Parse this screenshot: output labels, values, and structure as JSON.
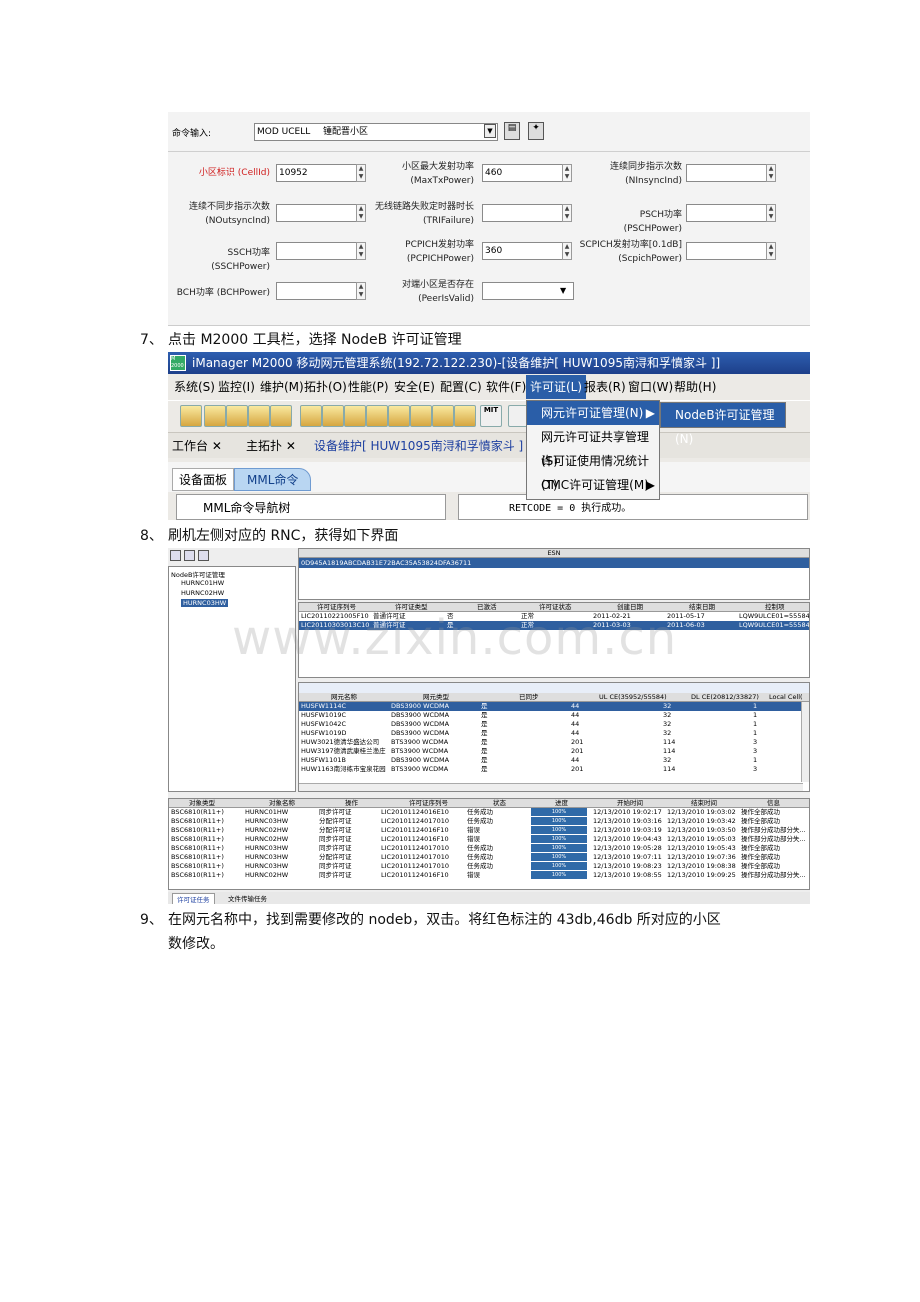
{
  "shot1": {
    "cmd_label": "命令输入:",
    "cmd_value": "MOD UCELL",
    "cmd_desc": "锺配晋小区",
    "fields": [
      {
        "label": "小区标识 (CellId)",
        "value": "10952"
      },
      {
        "label": "小区最大发射功率\n(MaxTxPower)",
        "value": "460"
      },
      {
        "label": "连续同步指示次数\n(NInsyncInd)",
        "value": ""
      },
      {
        "label": "连续不同步指示次数\n(NOutsyncInd)",
        "value": ""
      },
      {
        "label": "无线链路失败定时器时长\n(TRIFailure)",
        "value": ""
      },
      {
        "label": "PSCH功率 (PSCHPower)",
        "value": ""
      },
      {
        "label": "SSCH功率 (SSCHPower)",
        "value": ""
      },
      {
        "label": "PCPICH发射功率\n(PCPICHPower)",
        "value": "360"
      },
      {
        "label": "SCPICH发射功率[0.1dB]\n(ScpichPower)",
        "value": ""
      },
      {
        "label": "BCH功率 (BCHPower)",
        "value": ""
      },
      {
        "label": "对端小区是否存在\n(PeerIsValid)",
        "value": ""
      }
    ]
  },
  "step7": {
    "num": "7、",
    "text": "点击 M2000 工具栏，选择 NodeB 许可证管理"
  },
  "shot2": {
    "title": "iManager M2000 移动网元管理系统(192.72.122.230)-[设备维护[ HUW1095南浔和孚憤家斗 ]]",
    "menus": [
      "系统(S)",
      "监控(I)",
      "维护(M)",
      "拓扑(O)",
      "性能(P)",
      "安全(E)",
      "配置(C)",
      "软件(F)",
      "许可证(L)",
      "报表(R)",
      "窗口(W)",
      "帮助(H)"
    ],
    "tabs": [
      "工作台",
      "主拓扑",
      "设备维护[ HUW1095南浔和孚憤家斗 ]"
    ],
    "subtabs": [
      "设备面板",
      "MML命令"
    ],
    "tree_item": "MML命令导航树",
    "retcode": "RETCODE = 0  执行成功。",
    "dropdown": [
      "网元许可证管理(N)",
      "网元许可证共享管理(S)",
      "许可证使用情况统计(T)",
      "OMC许可证管理(M)"
    ],
    "submenu": "NodeB许可证管理(N)"
  },
  "step8": {
    "num": "8、",
    "text": "刷机左侧对应的 RNC，获得如下界面"
  },
  "shot3": {
    "tree_root": "NodeB许可证管理",
    "tree_items": [
      "HURNC01HW",
      "HURNC02HW",
      "HURNC03HW"
    ],
    "esn_header": "ESN",
    "esn_value": "0D945A1819ABCDAB31E72BAC35A53824DFA36711",
    "lic_headers": [
      "许可证序列号",
      "许可证类型",
      "已激活",
      "许可证状态",
      "创建日期",
      "结束日期",
      "控制项"
    ],
    "lic_rows": [
      [
        "LIC20110221005F10",
        "普通许可证",
        "否",
        "正常",
        "2011-02-21",
        "2011-05-17",
        "LQW9ULCE01=55584,..."
      ],
      [
        "LIC20110303013C10",
        "普通许可证",
        "是",
        "正常",
        "2011-03-03",
        "2011-06-03",
        "LQW9ULCE01=55584,..."
      ]
    ],
    "ne_headers": [
      "网元名称",
      "网元类型",
      "已同步",
      "UL CE(35952/55584)",
      "DL CE(20812/33827)",
      "Local Cell("
    ],
    "ne_rows": [
      [
        "HUSFW1114C",
        "DBS3900 WCDMA",
        "是",
        "44",
        "32",
        "1"
      ],
      [
        "HUSFW1019C",
        "DBS3900 WCDMA",
        "是",
        "44",
        "32",
        "1"
      ],
      [
        "HUSFW1042C",
        "DBS3900 WCDMA",
        "是",
        "44",
        "32",
        "1"
      ],
      [
        "HUSFW1019D",
        "DBS3900 WCDMA",
        "是",
        "44",
        "32",
        "1"
      ],
      [
        "HUW3021德清华盛达公司",
        "BTS3900 WCDMA",
        "是",
        "201",
        "114",
        "3"
      ],
      [
        "HUW3197德清武康桂兰渔庄",
        "BTS3900 WCDMA",
        "是",
        "201",
        "114",
        "3"
      ],
      [
        "HUSFW1101B",
        "DBS3900 WCDMA",
        "是",
        "44",
        "32",
        "1"
      ],
      [
        "HUW1163南浔练市宝泉花园",
        "BTS3900 WCDMA",
        "是",
        "201",
        "114",
        "3"
      ]
    ],
    "task_headers": [
      "对象类型",
      "对象名称",
      "操作",
      "许可证序列号",
      "状态",
      "进度",
      "开始时间",
      "结束时间",
      "信息"
    ],
    "task_rows": [
      [
        "BSC6810(R11+)",
        "HURNC01HW",
        "同步许可证",
        "LIC20101124016E10",
        "任务成功",
        "100%",
        "12/13/2010 19:02:17",
        "12/13/2010 19:03:02",
        "操作全部成功"
      ],
      [
        "BSC6810(R11+)",
        "HURNC03HW",
        "分配许可证",
        "LIC20101124017010",
        "任务成功",
        "100%",
        "12/13/2010 19:03:16",
        "12/13/2010 19:03:42",
        "操作全部成功"
      ],
      [
        "BSC6810(R11+)",
        "HURNC02HW",
        "分配许可证",
        "LIC20101124016F10",
        "错误",
        "100%",
        "12/13/2010 19:03:19",
        "12/13/2010 19:03:50",
        "操作部分成功部分失..."
      ],
      [
        "BSC6810(R11+)",
        "HURNC02HW",
        "同步许可证",
        "LIC20101124016F10",
        "错误",
        "100%",
        "12/13/2010 19:04:43",
        "12/13/2010 19:05:03",
        "操作部分成功部分失..."
      ],
      [
        "BSC6810(R11+)",
        "HURNC03HW",
        "同步许可证",
        "LIC20101124017010",
        "任务成功",
        "100%",
        "12/13/2010 19:05:28",
        "12/13/2010 19:05:43",
        "操作全部成功"
      ],
      [
        "BSC6810(R11+)",
        "HURNC03HW",
        "分配许可证",
        "LIC20101124017010",
        "任务成功",
        "100%",
        "12/13/2010 19:07:11",
        "12/13/2010 19:07:36",
        "操作全部成功"
      ],
      [
        "BSC6810(R11+)",
        "HURNC03HW",
        "同步许可证",
        "LIC20101124017010",
        "任务成功",
        "100%",
        "12/13/2010 19:08:23",
        "12/13/2010 19:08:38",
        "操作全部成功"
      ],
      [
        "BSC6810(R11+)",
        "HURNC02HW",
        "同步许可证",
        "LIC20101124016F10",
        "错误",
        "100%",
        "12/13/2010 19:08:55",
        "12/13/2010 19:09:25",
        "操作部分成功部分失..."
      ]
    ],
    "bottom_tabs": [
      "许可证任务",
      "文件传输任务"
    ]
  },
  "step9": {
    "num": "9、",
    "line1": "在网元名称中，找到需要修改的 nodeb，双击。将红色标注的 43db,46db 所对应的小区",
    "line2": "数修改。"
  },
  "watermark": "www.zixin.com.cn"
}
